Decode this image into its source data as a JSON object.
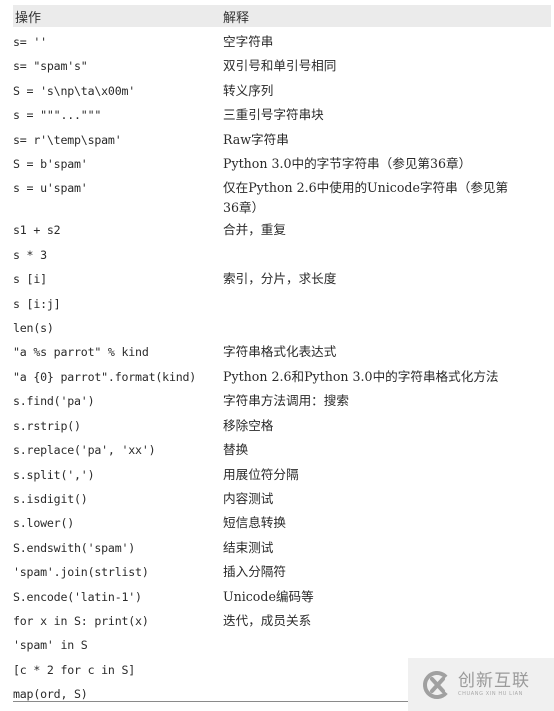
{
  "table": {
    "headers": {
      "operation": "操作",
      "explanation": "解释"
    },
    "rows": [
      {
        "op": "s= ''",
        "desc": "空字符串"
      },
      {
        "op": "s= \"spam's\"",
        "desc": "双引号和单引号相同"
      },
      {
        "op": "S = 's\\np\\ta\\x00m'",
        "desc": "转义序列"
      },
      {
        "op": "s = \"\"\"...\"\"\"",
        "desc": "三重引号字符串块"
      },
      {
        "op": "s= r'\\temp\\spam'",
        "desc": "Raw字符串"
      },
      {
        "op": "S = b'spam'",
        "desc": "Python 3.0中的字节字符串（参见第36章）"
      },
      {
        "op": "s = u'spam'",
        "desc": "仅在Python 2.6中使用的Unicode字符串（参见第36章）"
      },
      {
        "op": "s1 + s2",
        "desc": "合并，重复"
      },
      {
        "op": "s * 3",
        "desc": ""
      },
      {
        "op": "s [i]",
        "desc": "索引，分片，求长度"
      },
      {
        "op": "s [i:j]",
        "desc": ""
      },
      {
        "op": "len(s)",
        "desc": ""
      },
      {
        "op": "\"a %s parrot\" % kind",
        "desc": "字符串格式化表达式"
      },
      {
        "op": "\"a {0} parrot\".format(kind)",
        "desc": "Python 2.6和Python 3.0中的字符串格式化方法"
      },
      {
        "op": "s.find('pa')",
        "desc": "字符串方法调用：搜索"
      },
      {
        "op": "s.rstrip()",
        "desc": "移除空格"
      },
      {
        "op": "s.replace('pa', 'xx')",
        "desc": "替换"
      },
      {
        "op": "s.split(',')",
        "desc": "用展位符分隔"
      },
      {
        "op": "s.isdigit()",
        "desc": "内容测试"
      },
      {
        "op": "s.lower()",
        "desc": "短信息转换"
      },
      {
        "op": "S.endswith('spam')",
        "desc": "结束测试"
      },
      {
        "op": "'spam'.join(strlist)",
        "desc": "插入分隔符"
      },
      {
        "op": "S.encode('latin-1')",
        "desc": "Unicode编码等"
      },
      {
        "op": "for x in S: print(x)",
        "desc": "迭代，成员关系"
      },
      {
        "op": "'spam' in S",
        "desc": ""
      },
      {
        "op": "[c * 2 for c in S]",
        "desc": ""
      },
      {
        "op": "map(ord, S)",
        "desc": ""
      }
    ]
  },
  "watermark": {
    "icon": "chuangxin-logo-icon",
    "name_cn": "创新互联",
    "name_en": "CHUANG XIN HU LIAN"
  },
  "colors": {
    "header_bg": "#ebebeb",
    "text": "#2a2a2a",
    "rule": "#8a8a8a",
    "watermark": "#9a9a9a"
  }
}
